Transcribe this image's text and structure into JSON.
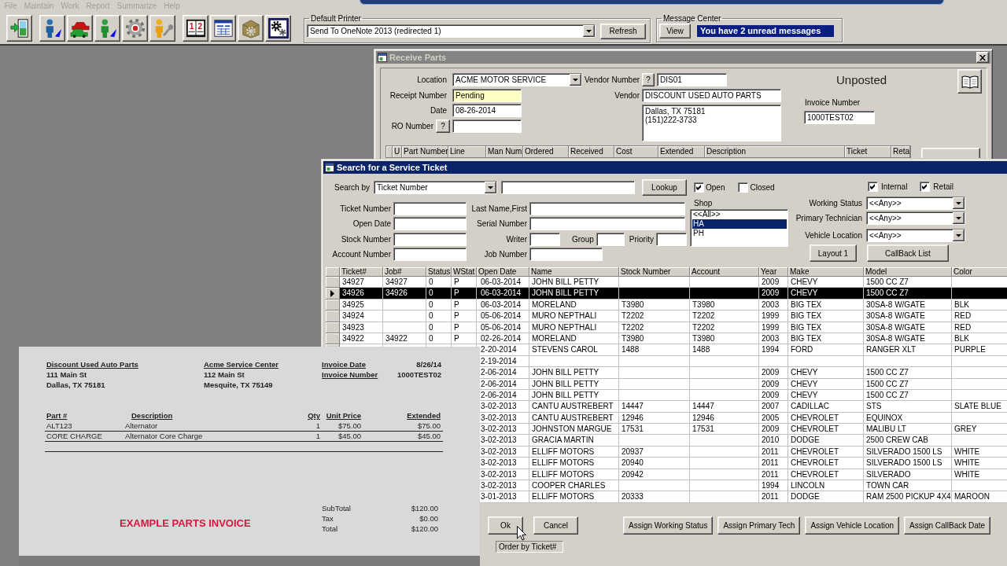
{
  "menu": [
    {
      "label": "File",
      "disabled": true
    },
    {
      "label": "Maintain",
      "disabled": true
    },
    {
      "label": "Work",
      "disabled": true
    },
    {
      "label": "Report",
      "disabled": true
    },
    {
      "label": "Summarize",
      "disabled": true
    },
    {
      "label": "Help",
      "disabled": true
    }
  ],
  "toolbar": {
    "groups": [
      [
        {
          "kind": "exit"
        }
      ],
      [
        {
          "kind": "person_blue"
        },
        {
          "kind": "cars"
        },
        {
          "kind": "person_green"
        },
        {
          "kind": "gear"
        },
        {
          "kind": "mechanic"
        }
      ],
      [
        {
          "kind": "calendar",
          "digits": [
            "1",
            "2"
          ]
        },
        {
          "kind": "form"
        },
        {
          "kind": "box"
        },
        {
          "kind": "gears"
        }
      ]
    ]
  },
  "default_printer": {
    "title": "Default Printer",
    "value": "Send To OneNote 2013 (redirected 1)",
    "button": "Refresh"
  },
  "message_center": {
    "title": "Message Center",
    "button": "View",
    "message": "You have 2 unread messages"
  },
  "receive_parts": {
    "title": "Receive Parts",
    "location": {
      "label": "Location",
      "value": "ACME MOTOR SERVICE"
    },
    "receipt_number": {
      "label": "Receipt Number",
      "value": "Pending"
    },
    "date": {
      "label": "Date",
      "value": "08-26-2014"
    },
    "ro_number": {
      "label": "RO Number",
      "button": "?"
    },
    "vendor_number": {
      "label": "Vendor Number",
      "button": "?",
      "value": "DIS01"
    },
    "vendor": {
      "label": "Vendor",
      "value": "DISCOUNT USED AUTO PARTS",
      "address": [
        "Dallas, TX 75181",
        "(151)222-3733"
      ]
    },
    "status": "Unposted",
    "invoice_number": {
      "label": "Invoice Number",
      "value": "1000TEST02"
    },
    "grid_columns": [
      "U",
      "Part Number",
      "Line",
      "Man Num",
      "Ordered",
      "Received",
      "Cost",
      "Extended",
      "Description",
      "Ticket",
      "Reta"
    ]
  },
  "search_ticket": {
    "title": "Search for a Service Ticket",
    "search_by": {
      "label": "Search by",
      "value": "Ticket Number"
    },
    "lookup_button": "Lookup",
    "view_filters": [
      {
        "label": "Open",
        "checked": true
      },
      {
        "label": "Closed",
        "checked": false
      }
    ],
    "type_filters": [
      {
        "label": "Internal",
        "checked": true
      },
      {
        "label": "Retail",
        "checked": true
      }
    ],
    "ticket_fields": [
      "Ticket Number",
      "Open Date",
      "Stock Number",
      "Account Number"
    ],
    "last_name": "Last Name,First",
    "serial_number": "Serial Number",
    "writer": "Writer",
    "group": "Group",
    "priority": "Priority",
    "job_number": "Job Number",
    "shop": {
      "label": "Shop",
      "items": [
        {
          "label": "<<All>>",
          "selected": false
        },
        {
          "label": "HA",
          "selected": true
        },
        {
          "label": "PH",
          "selected": false
        }
      ]
    },
    "filters": [
      {
        "label": "Working Status",
        "value": "<<Any>>"
      },
      {
        "label": "Primary Technician",
        "value": "<<Any>>"
      },
      {
        "label": "Vehicle Location",
        "value": "<<Any>>"
      }
    ],
    "layout_button": "Layout 1",
    "callback_button": "CallBack List",
    "table": {
      "columns": [
        "Ticket#",
        "Job#",
        "Status",
        "WStat",
        "Open Date",
        "Name",
        "Stock Number",
        "Account",
        "Year",
        "Make",
        "Model",
        "Color"
      ],
      "rows": [
        {
          "ticket": "34927",
          "job": "34927",
          "status": "0",
          "wstat": "P",
          "open_date": "06-03-2014",
          "name": "JOHN BILL PETTY",
          "year": "2009",
          "make": "CHEVY",
          "model": "1500 CC Z7",
          "selected": false
        },
        {
          "ticket": "34926",
          "job": "34926",
          "status": "0",
          "wstat": "P",
          "open_date": "06-03-2014",
          "name": "JOHN BILL PETTY",
          "year": "2009",
          "make": "CHEVY",
          "model": "1500 CC Z7",
          "selected": true
        },
        {
          "ticket": "34925",
          "status": "0",
          "wstat": "P",
          "open_date": "06-03-2014",
          "name": "MORELAND",
          "stock_number": "T3980",
          "account": "T3980",
          "year": "2003",
          "make": "BIG TEX",
          "model": "30SA-8 W/GATE",
          "vehicle_color": "BLK",
          "selected": false
        },
        {
          "ticket": "34924",
          "status": "0",
          "wstat": "P",
          "open_date": "05-06-2014",
          "name": "MURO NEPTHALI",
          "stock_number": "T2202",
          "account": "T2202",
          "year": "1999",
          "make": "BIG TEX",
          "model": "30SA-8 W/GATE",
          "vehicle_color": "RED",
          "selected": false
        },
        {
          "ticket": "34923",
          "status": "0",
          "wstat": "P",
          "open_date": "05-06-2014",
          "name": "MURO NEPTHALI",
          "stock_number": "T2202",
          "account": "T2202",
          "year": "1999",
          "make": "BIG TEX",
          "model": "30SA-8 W/GATE",
          "vehicle_color": "RED",
          "selected": false
        },
        {
          "ticket": "34922",
          "job": "34922",
          "status": "0",
          "wstat": "P",
          "open_date": "02-26-2014",
          "name": "MORELAND",
          "stock_number": "T3980",
          "account": "T3980",
          "year": "2003",
          "make": "BIG TEX",
          "model": "30SA-8 W/GATE",
          "vehicle_color": "BLK",
          "selected": false
        },
        {
          "open_date": "2-20-2014",
          "name": "STEVENS CAROL",
          "stock_number": "1488",
          "account": "1488",
          "year": "1994",
          "make": "FORD",
          "model": "RANGER XLT",
          "vehicle_color": "PURPLE",
          "selected": false
        },
        {
          "open_date": "2-19-2014",
          "selected": false
        },
        {
          "open_date": "2-06-2014",
          "name": "JOHN BILL PETTY",
          "year": "2009",
          "make": "CHEVY",
          "model": "1500 CC Z7",
          "selected": false
        },
        {
          "open_date": "2-06-2014",
          "name": "JOHN BILL PETTY",
          "year": "2009",
          "make": "CHEVY",
          "model": "1500 CC Z7",
          "selected": false
        },
        {
          "open_date": "2-06-2014",
          "name": "JOHN BILL PETTY",
          "year": "2009",
          "make": "CHEVY",
          "model": "1500 CC Z7",
          "selected": false
        },
        {
          "open_date": "3-02-2013",
          "name": "CANTU AUSTREBERT",
          "stock_number": "14447",
          "account": "14447",
          "year": "2007",
          "make": "CADILLAC",
          "model": "STS",
          "vehicle_color": "SLATE BLUE",
          "selected": false
        },
        {
          "open_date": "3-02-2013",
          "name": "CANTU AUSTREBERT",
          "stock_number": "12946",
          "account": "12946",
          "year": "2005",
          "make": "CHEVROLET",
          "model": "EQUINOX",
          "selected": false
        },
        {
          "open_date": "3-02-2013",
          "name": "JOHNSTON MARGUE",
          "stock_number": "17531",
          "account": "17531",
          "year": "2009",
          "make": "CHEVROLET",
          "model": "MALIBU LT",
          "vehicle_color": "GREY",
          "selected": false
        },
        {
          "open_date": "3-02-2013",
          "name": "GRACIA MARTIN",
          "year": "2010",
          "make": "DODGE",
          "model": "2500 CREW CAB",
          "selected": false
        },
        {
          "open_date": "3-02-2013",
          "name": "ELLIFF MOTORS",
          "stock_number": "20937",
          "year": "2011",
          "make": "CHEVROLET",
          "model": "SILVERADO 1500 LS",
          "vehicle_color": "WHITE",
          "selected": false
        },
        {
          "open_date": "3-02-2013",
          "name": "ELLIFF MOTORS",
          "stock_number": "20940",
          "year": "2011",
          "make": "CHEVROLET",
          "model": "SILVERADO 1500 LS",
          "vehicle_color": "WHITE",
          "selected": false
        },
        {
          "open_date": "3-02-2013",
          "name": "ELLIFF MOTORS",
          "stock_number": "20942",
          "year": "2011",
          "make": "CHEVROLET",
          "model": "SILVERADO",
          "vehicle_color": "WHITE",
          "selected": false
        },
        {
          "open_date": "3-02-2013",
          "name": "COOPER CHARLES",
          "year": "1994",
          "make": "LINCOLN",
          "model": "TOWN CAR",
          "selected": false
        },
        {
          "open_date": "3-01-2013",
          "name": "ELLIFF MOTORS",
          "stock_number": "20333",
          "year": "2011",
          "make": "DODGE",
          "model": "RAM 2500 PICKUP 4X4",
          "vehicle_color": "MAROON",
          "selected": false
        }
      ]
    },
    "buttons": [
      "Ok",
      "Cancel"
    ],
    "assign_buttons": [
      "Assign Working Status",
      "Assign Primary Tech",
      "Assign Vehicle Location",
      "Assign CallBack Date"
    ],
    "status_bar": "Order by Ticket#"
  },
  "invoice": {
    "from": {
      "name": "Discount Used Auto Parts",
      "lines": [
        "111 Main St",
        "Dallas, TX 75181"
      ]
    },
    "to": {
      "name": "Acme Service Center",
      "lines": [
        "112 Main St",
        "Mesquite, TX 75149"
      ]
    },
    "meta": [
      {
        "label": "Invoice Date",
        "value": "8/26/14"
      },
      {
        "label": "Invoice Number",
        "value": "1000TEST02"
      }
    ],
    "columns": [
      "Part #",
      "Description",
      "Qty",
      "Unit Price",
      "Extended"
    ],
    "items": [
      {
        "part": "ALT123",
        "description": "Alternator",
        "qty": "1",
        "unit_price": "$75.00",
        "extended": "$75.00"
      },
      {
        "part": "CORE CHARGE",
        "description": "Alternator Core Charge",
        "qty": "1",
        "unit_price": "$45.00",
        "extended": "$45.00"
      }
    ],
    "totals": [
      {
        "label": "SubTotal",
        "value": "$120.00"
      },
      {
        "label": "Tax",
        "value": "$0.00"
      },
      {
        "label": "Total",
        "value": "$120.00"
      }
    ],
    "caption": "EXAMPLE PARTS INVOICE"
  }
}
